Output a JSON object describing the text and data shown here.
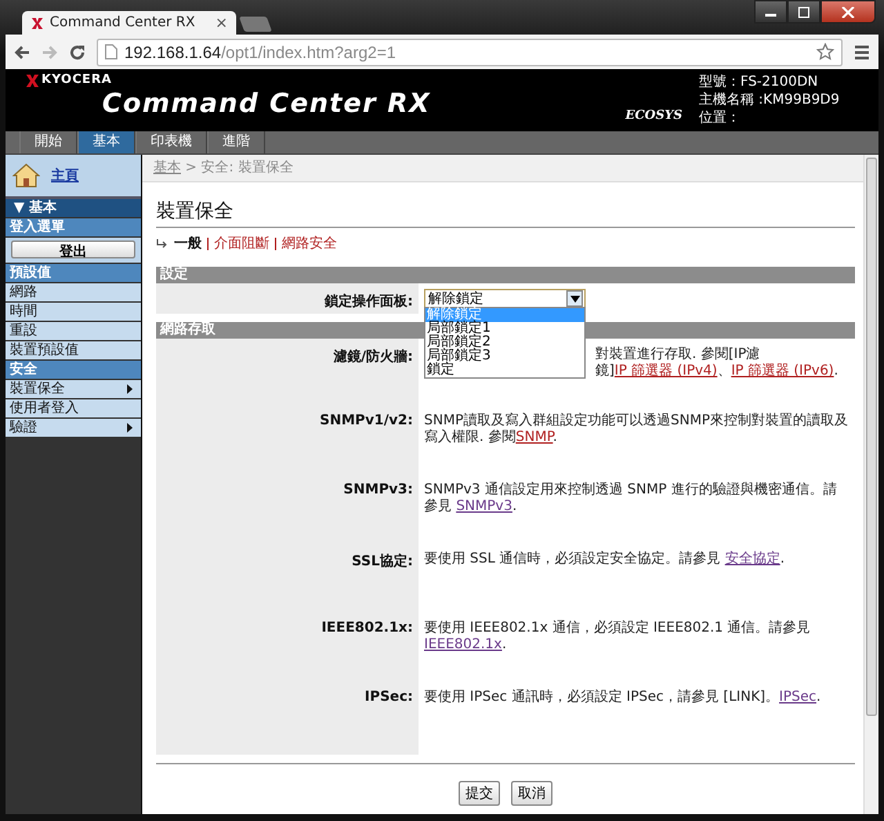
{
  "browser": {
    "tab_title": "Command Center RX",
    "tab_close": "×",
    "url_host": "192.168.1.64",
    "url_path": "/opt1/index.htm?arg2=1"
  },
  "header": {
    "brand": "KYOCERA",
    "product": "Command Center RX",
    "ecosys": "ECOSYS",
    "info": [
      "型號：FS-2100DN",
      "主機名稱 :KM99B9D9",
      "位置："
    ]
  },
  "tabs": [
    {
      "label": "開始",
      "selected": false
    },
    {
      "label": "基本",
      "selected": true
    },
    {
      "label": "印表機",
      "selected": false
    },
    {
      "label": "進階",
      "selected": false
    }
  ],
  "sidebar": {
    "home": "主頁",
    "items": [
      {
        "kind": "group",
        "label": "▼ 基本"
      },
      {
        "kind": "header",
        "label": "登入選單"
      },
      {
        "kind": "button",
        "label": "登出"
      },
      {
        "kind": "header",
        "label": "預設值"
      },
      {
        "kind": "item",
        "label": "網路",
        "submenu": false
      },
      {
        "kind": "item",
        "label": "時間",
        "submenu": false
      },
      {
        "kind": "item",
        "label": "重設",
        "submenu": false
      },
      {
        "kind": "item",
        "label": "裝置預設值",
        "submenu": false
      },
      {
        "kind": "header",
        "label": "安全"
      },
      {
        "kind": "item",
        "label": "裝置保全",
        "submenu": true
      },
      {
        "kind": "item",
        "label": "使用者登入",
        "submenu": false
      },
      {
        "kind": "item",
        "label": "驗證",
        "submenu": true
      }
    ]
  },
  "breadcrumb": {
    "link": "基本",
    "rest": " > 安全: 裝置保全"
  },
  "title": "裝置保全",
  "subnav": [
    {
      "label": "一般",
      "selected": true
    },
    {
      "label": "介面阻斷",
      "selected": false
    },
    {
      "label": "網路安全",
      "selected": false
    }
  ],
  "sections": [
    {
      "title": "設定",
      "rows": [
        {
          "kind": "select",
          "label": "鎖定操作面板:",
          "value": "解除鎖定",
          "options": [
            {
              "label": "解除鎖定",
              "selected": true
            },
            {
              "label": "局部鎖定1",
              "selected": false
            },
            {
              "label": "局部鎖定2",
              "selected": false
            },
            {
              "label": "局部鎖定3",
              "selected": false
            },
            {
              "label": "鎖定",
              "selected": false
            }
          ]
        }
      ]
    },
    {
      "title": "網路存取",
      "rows": [
        {
          "kind": "text",
          "label": "濾鏡/防火牆:",
          "beside_list": true,
          "parts": [
            {
              "text": "對裝置進行存取. 參閱[IP濾鏡]"
            },
            {
              "link": "IP 篩選器 (IPv4)",
              "visited": false
            },
            {
              "text": "、"
            },
            {
              "link": "IP 篩選器 (IPv6)",
              "visited": false
            },
            {
              "text": "."
            }
          ]
        },
        {
          "kind": "text",
          "label": "SNMPv1/v2:",
          "parts": [
            {
              "text": "SNMP讀取及寫入群組設定功能可以透過SNMP來控制對裝置的讀取及寫入權限. 參閱"
            },
            {
              "link": "SNMP",
              "visited": false
            },
            {
              "text": "."
            }
          ]
        },
        {
          "kind": "text",
          "label": "SNMPv3:",
          "parts": [
            {
              "text": "SNMPv3 通信設定用來控制透過 SNMP 進行的驗證與機密通信。請參見 "
            },
            {
              "link": "SNMPv3",
              "visited": true
            },
            {
              "text": "."
            }
          ]
        },
        {
          "kind": "text",
          "label": "SSL協定:",
          "parts": [
            {
              "text": "要使用 SSL 通信時，必須設定安全協定。請參見 "
            },
            {
              "link": "安全協定",
              "visited": true
            },
            {
              "text": "."
            }
          ]
        },
        {
          "kind": "text",
          "label": "IEEE802.1x:",
          "parts": [
            {
              "text": "要使用 IEEE802.1x 通信，必須設定 IEEE802.1 通信。請參見"
            },
            {
              "link": "IEEE802.1x",
              "visited": true
            },
            {
              "text": "."
            }
          ]
        },
        {
          "kind": "text",
          "label": "IPSec:",
          "parts": [
            {
              "text": "要使用 IPSec 通訊時，必須設定 IPSec，請參見 [LINK]。"
            },
            {
              "link": "IPSec",
              "visited": true
            },
            {
              "text": "."
            }
          ]
        }
      ]
    }
  ],
  "buttons": [
    "提交",
    "取消"
  ]
}
